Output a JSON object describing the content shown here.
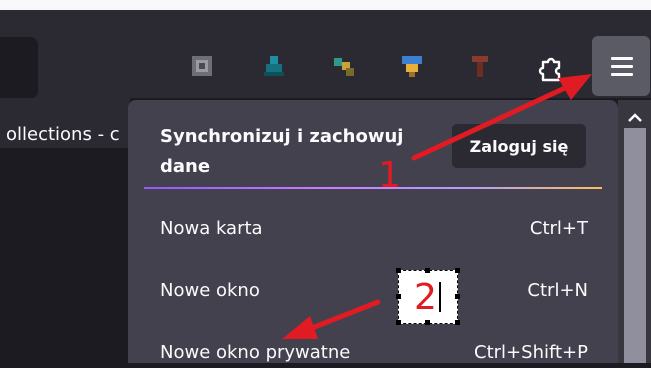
{
  "tab": {
    "title": "ollections - c"
  },
  "menu_panel": {
    "sync_label": "Synchronizuj i zachowuj dane",
    "login_button": "Zaloguj się",
    "items": [
      {
        "label": "Nowa karta",
        "shortcut": "Ctrl+T"
      },
      {
        "label": "Nowe okno",
        "shortcut": "Ctrl+N"
      },
      {
        "label": "Nowe okno prywatne",
        "shortcut": "Ctrl+Shift+P"
      }
    ]
  },
  "annotations": {
    "step1": "1",
    "step2": "2"
  },
  "colors": {
    "annotation": "#e01b24",
    "panel": "#42414d",
    "toolbar": "#2b2a33",
    "menu_button_active": "#5b5b66"
  },
  "icons": [
    "extension-icon-gray",
    "extension-icon-teal",
    "extension-icon-green",
    "extension-icon-blue",
    "extension-icon-red",
    "puzzle-extensions-icon",
    "hamburger-menu-icon"
  ]
}
